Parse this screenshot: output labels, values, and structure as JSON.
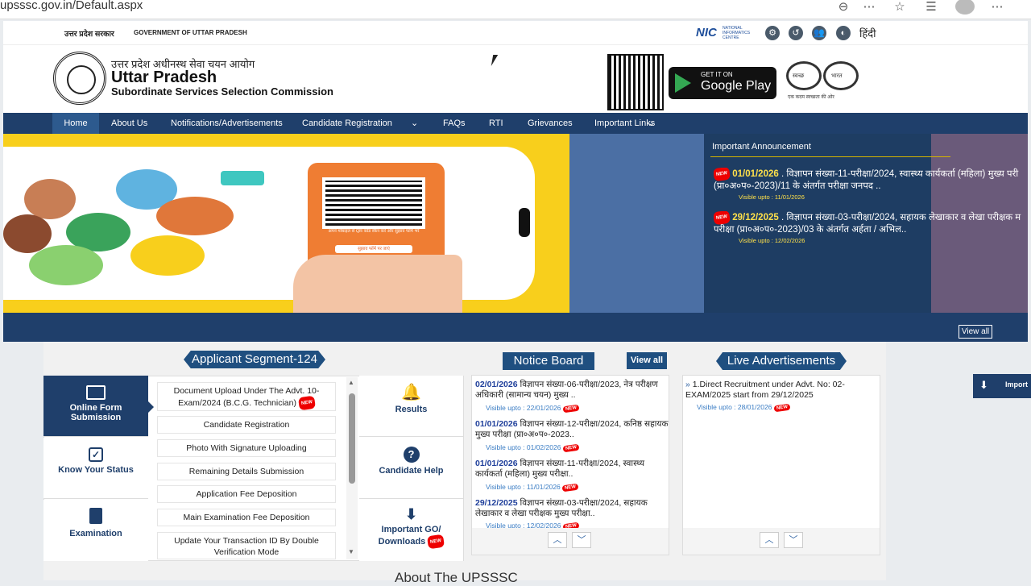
{
  "browser": {
    "url": "upsssc.gov.in/Default.aspx"
  },
  "top_strip": {
    "left1": "उत्तर प्रदेश सरकार",
    "left2": "GOVERNMENT OF UTTAR PRADESH",
    "nic_label": "NATIONAL INFORMATICS CENTRE",
    "nic": "NIC",
    "lang": "हिंदी"
  },
  "header": {
    "hindi_title": "उत्तर प्रदेश अधीनस्थ सेवा चयन आयोग",
    "title": "Uttar Pradesh",
    "subtitle": "Subordinate Services Selection Commission",
    "google_play_small": "GET IT ON",
    "google_play_big": "Google Play",
    "swachh_line": "एक कदम स्वच्छता की ओर",
    "swachh_left": "स्वच्छ",
    "swachh_right": "भारत"
  },
  "nav": {
    "items": [
      "Home",
      "About Us",
      "Notifications/Advertisements",
      "Candidate Registration",
      "FAQs",
      "RTI",
      "Grievances",
      "Important Links"
    ]
  },
  "banner": {
    "phone_text": "अपने मोबाइल से QR कोड स्कैन करें और सुझाव फॉर्म भरें",
    "phone_btn": "सुझाव फॉर्म पर जाएं"
  },
  "announcement": {
    "title": "Important Announcement",
    "items": [
      {
        "date": "01/01/2026",
        "text": ". विज्ञापन संख्या-11-परीक्षा/2024, स्वास्थ्य कार्यकर्ता (महिला) मुख्य परी (प्रा०अ०प०-2023)/11 के अंतर्गत परीक्षा जनपद ..",
        "visible": "Visible upto : 11/01/2026"
      },
      {
        "date": "29/12/2025",
        "text": ". विज्ञापन संख्या-03-परीक्षा/2024, सहायक लेखाकार व लेखा परीक्षक म परीक्षा (प्रा०अ०प०-2023)/03 के अंतर्गत अर्हता / अभिल..",
        "visible": "Visible upto : 12/02/2026"
      }
    ],
    "view_all": "View all"
  },
  "applicant": {
    "title": "Applicant Segment-124",
    "left": [
      {
        "label": "Online Form Submission"
      },
      {
        "label": "Know Your Status"
      },
      {
        "label": "Examination"
      }
    ],
    "list": [
      "Document Upload Under The Advt. 10-Exam/2024 (B.C.G. Technician)",
      "Candidate Registration",
      "Photo With Signature Uploading",
      "Remaining Details Submission",
      "Application Fee Deposition",
      "Main Examination Fee Deposition",
      "Update Your Transaction ID By Double Verification Mode"
    ],
    "right": [
      {
        "label": "Results"
      },
      {
        "label": "Candidate Help"
      },
      {
        "label": "Important GO/ Downloads"
      }
    ]
  },
  "notice_board": {
    "title": "Notice Board",
    "view_all": "View all",
    "items": [
      {
        "date": "02/01/2026",
        "text": " विज्ञापन संख्या-06-परीक्षा/2023, नेत्र परीक्षण अधिकारी (सामान्य चयन) मुख्य ..",
        "visible": "Visible upto : 22/01/2026"
      },
      {
        "date": "01/01/2026",
        "text": " विज्ञापन संख्या-12-परीक्षा/2024, कनिष्ठ सहायक मुख्य परीक्षा (प्रा०अ०प०-2023..",
        "visible": "Visible upto : 01/02/2026"
      },
      {
        "date": "01/01/2026",
        "text": " विज्ञापन संख्या-11-परीक्षा/2024, स्वास्थ्य कार्यकर्ता (महिला) मुख्य परीक्षा..",
        "visible": "Visible upto : 11/01/2026"
      },
      {
        "date": "29/12/2025",
        "text": " विज्ञापन संख्या-03-परीक्षा/2024, सहायक लेखाकार व लेखा परीक्षक मुख्य परीक्षा..",
        "visible": "Visible upto : 12/02/2026"
      }
    ]
  },
  "live_ads": {
    "title": "Live Advertisements",
    "items": [
      {
        "text": "1.Direct Recruitment under Advt. No: 02-EXAM/2025 start from 29/12/2025",
        "visible": "Visible upto : 28/01/2026"
      }
    ]
  },
  "side_tab": {
    "label": "Import"
  },
  "about_heading": "About The UPSSSC",
  "new_badge": "NEW"
}
